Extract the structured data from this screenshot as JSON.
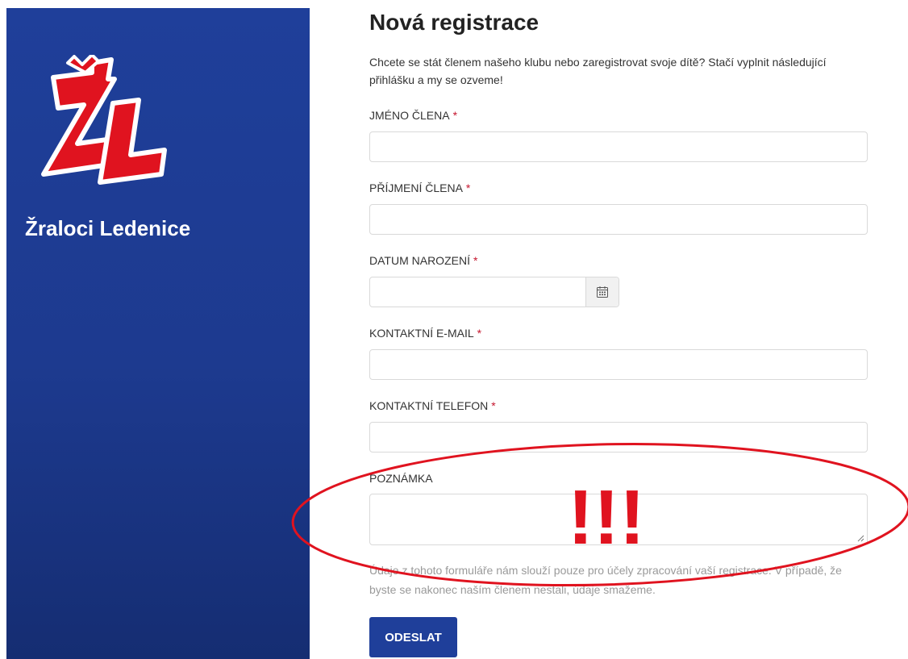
{
  "sidebar": {
    "club_name": "Žraloci Ledenice"
  },
  "form": {
    "title": "Nová registrace",
    "intro": "Chcete se stát členem našeho klubu nebo zaregistrovat svoje dítě? Stačí vyplnit následující přihlášku a my se ozveme!",
    "required_mark": "*",
    "fields": [
      {
        "label": "JMÉNO ČLENA",
        "value": "",
        "required": true
      },
      {
        "label": "PŘÍJMENÍ ČLENA",
        "value": "",
        "required": true
      },
      {
        "label": "DATUM NAROZENÍ",
        "value": "",
        "required": true
      },
      {
        "label": "KONTAKTNÍ E-MAIL",
        "value": "",
        "required": true
      },
      {
        "label": "KONTAKTNÍ TELEFON",
        "value": "",
        "required": true
      },
      {
        "label": "POZNÁMKA",
        "value": "",
        "required": false
      }
    ],
    "privacy_note": "Údaje z tohoto formuláře nám slouží pouze pro účely zpracování vaší registrace. V případě, že byste se nakonec naším členem nestali, údaje smažeme.",
    "submit_label": "ODESLAT"
  },
  "annotation": {
    "text": "!!!",
    "color": "#e0131f"
  },
  "colors": {
    "sidebar_blue": "#1f3f9a",
    "required_red": "#c5162e",
    "logo_red": "#e0131f"
  }
}
